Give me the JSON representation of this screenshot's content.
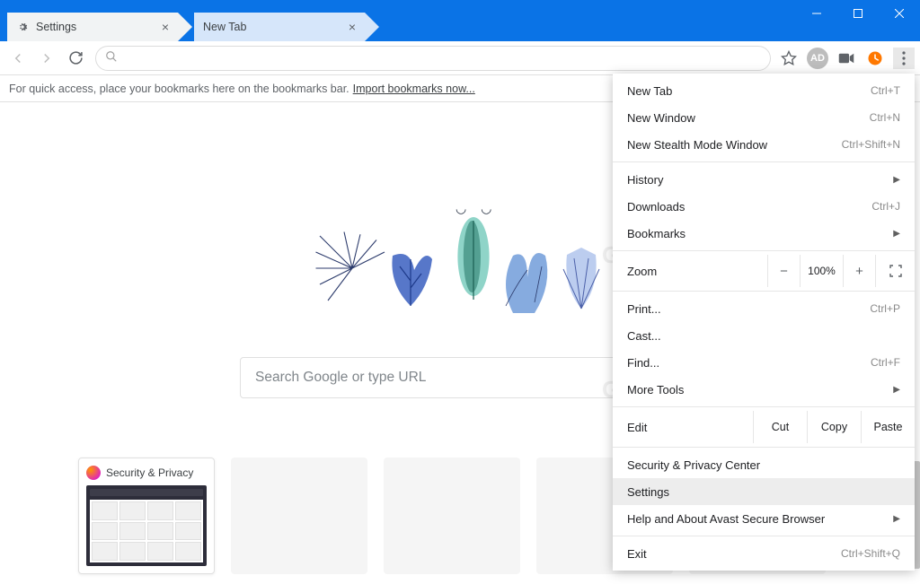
{
  "tabs": [
    {
      "label": "Settings",
      "has_icon": true
    },
    {
      "label": "New Tab",
      "has_icon": false
    }
  ],
  "bookmarks_bar": {
    "hint": "For quick access, place your bookmarks here on the bookmarks bar.",
    "link": "Import bookmarks now..."
  },
  "searchbox_placeholder": "Search Google or type URL",
  "toolbar_icons": {
    "ad_label": "AD"
  },
  "shortcuts": [
    {
      "label": "Security & Privacy"
    }
  ],
  "menu": {
    "basic": [
      {
        "label": "New Tab",
        "shortcut": "Ctrl+T"
      },
      {
        "label": "New Window",
        "shortcut": "Ctrl+N"
      },
      {
        "label": "New Stealth Mode Window",
        "shortcut": "Ctrl+Shift+N"
      }
    ],
    "nav": [
      {
        "label": "History",
        "arrow": true
      },
      {
        "label": "Downloads",
        "shortcut": "Ctrl+J"
      },
      {
        "label": "Bookmarks",
        "arrow": true
      }
    ],
    "zoom": {
      "label": "Zoom",
      "value": "100%"
    },
    "tools": [
      {
        "label": "Print...",
        "shortcut": "Ctrl+P"
      },
      {
        "label": "Cast..."
      },
      {
        "label": "Find...",
        "shortcut": "Ctrl+F"
      },
      {
        "label": "More Tools",
        "arrow": true
      }
    ],
    "edit": {
      "label": "Edit",
      "cut": "Cut",
      "copy": "Copy",
      "paste": "Paste"
    },
    "bottom": [
      {
        "label": "Security & Privacy Center"
      },
      {
        "label": "Settings",
        "highlight": true
      },
      {
        "label": "Help and About Avast Secure Browser",
        "arrow": true
      }
    ],
    "exit": {
      "label": "Exit",
      "shortcut": "Ctrl+Shift+Q"
    }
  },
  "watermark": "Geeker"
}
